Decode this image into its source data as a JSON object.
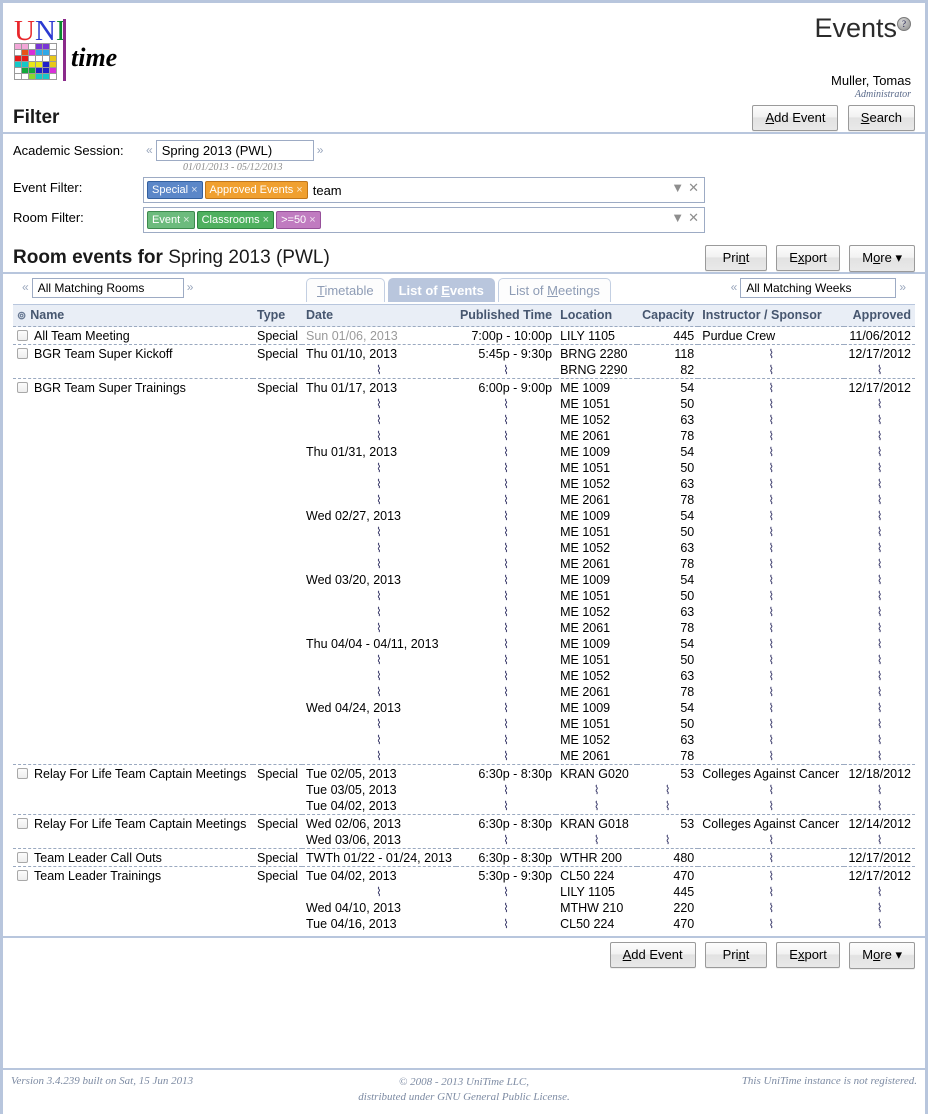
{
  "header": {
    "logo_uni": [
      "U",
      "N",
      "I"
    ],
    "logo_time": "time",
    "app_title": "Events",
    "help_icon": "?",
    "user_name": "Muller, Tomas",
    "user_role": "Administrator"
  },
  "filter": {
    "title": "Filter",
    "add_event_label": "Add Event",
    "add_event_accel": "A",
    "search_label": "Search",
    "search_accel": "S",
    "academic_session_label": "Academic Session:",
    "academic_session_value": "Spring 2013 (PWL)",
    "academic_session_range": "01/01/2013 - 05/12/2013",
    "event_filter_label": "Event Filter:",
    "event_filter_tags": [
      {
        "text": "Special",
        "color": "#5b87c8"
      },
      {
        "text": "Approved Events",
        "color": "#f0a030"
      }
    ],
    "event_filter_text": "team",
    "room_filter_label": "Room Filter:",
    "room_filter_tags": [
      {
        "text": "Event",
        "color": "#6cbb7d"
      },
      {
        "text": "Classrooms",
        "color": "#4eb05f"
      },
      {
        "text": ">=50",
        "color": "#c07bc0"
      }
    ],
    "prev_chevron": "«",
    "next_chevron": "»",
    "dropdown_icon": "▼",
    "clear_icon": "✕",
    "tag_remove": "×"
  },
  "results": {
    "title_prefix": "Room events for ",
    "title_session": "Spring 2013 (PWL)",
    "print_label": "Print",
    "print_accel": "n",
    "export_label": "Export",
    "export_accel": "x",
    "more_label": "More",
    "more_accel": "o",
    "more_caret": "▾",
    "rooms_value": "All Matching Rooms",
    "weeks_value": "All Matching Weeks",
    "tabs": [
      {
        "label": "Timetable",
        "accel": "T",
        "active": false
      },
      {
        "label": "List of Events",
        "accel": "E",
        "active": true
      },
      {
        "label": "List of Meetings",
        "accel": "M",
        "active": false
      }
    ],
    "columns": [
      "Name",
      "Type",
      "Date",
      "Published Time",
      "Location",
      "Capacity",
      "Instructor / Sponsor",
      "Approved"
    ],
    "sort_icon": "⊚",
    "ditto": "⌇",
    "rows": [
      {
        "name": "All Team Meeting",
        "type": "Special",
        "meetings": [
          {
            "date": "Sun 01/06, 2013",
            "date_past": true,
            "time": "7:00p - 10:00p",
            "location": "LILY 1105",
            "capacity": "445",
            "sponsor": "Purdue Crew",
            "approved": "11/06/2012"
          }
        ]
      },
      {
        "name": "BGR Team Super Kickoff",
        "type": "Special",
        "meetings": [
          {
            "date": "Thu 01/10, 2013",
            "time": "5:45p - 9:30p",
            "location": "BRNG 2280",
            "capacity": "118",
            "sponsor": "",
            "approved": "12/17/2012"
          },
          {
            "date": "",
            "time": "",
            "location": "BRNG 2290",
            "capacity": "82",
            "sponsor": "",
            "approved": ""
          }
        ]
      },
      {
        "name": "BGR Team Super Trainings",
        "type": "Special",
        "meetings": [
          {
            "date": "Thu 01/17, 2013",
            "time": "6:00p - 9:00p",
            "location": "ME 1009",
            "capacity": "54",
            "sponsor": "",
            "approved": "12/17/2012"
          },
          {
            "date": "",
            "time": "",
            "location": "ME 1051",
            "capacity": "50",
            "sponsor": "",
            "approved": ""
          },
          {
            "date": "",
            "time": "",
            "location": "ME 1052",
            "capacity": "63",
            "sponsor": "",
            "approved": ""
          },
          {
            "date": "",
            "time": "",
            "location": "ME 2061",
            "capacity": "78",
            "sponsor": "",
            "approved": ""
          },
          {
            "date": "Thu 01/31, 2013",
            "time": "",
            "location": "ME 1009",
            "capacity": "54",
            "sponsor": "",
            "approved": ""
          },
          {
            "date": "",
            "time": "",
            "location": "ME 1051",
            "capacity": "50",
            "sponsor": "",
            "approved": ""
          },
          {
            "date": "",
            "time": "",
            "location": "ME 1052",
            "capacity": "63",
            "sponsor": "",
            "approved": ""
          },
          {
            "date": "",
            "time": "",
            "location": "ME 2061",
            "capacity": "78",
            "sponsor": "",
            "approved": ""
          },
          {
            "date": "Wed 02/27, 2013",
            "time": "",
            "location": "ME 1009",
            "capacity": "54",
            "sponsor": "",
            "approved": ""
          },
          {
            "date": "",
            "time": "",
            "location": "ME 1051",
            "capacity": "50",
            "sponsor": "",
            "approved": ""
          },
          {
            "date": "",
            "time": "",
            "location": "ME 1052",
            "capacity": "63",
            "sponsor": "",
            "approved": ""
          },
          {
            "date": "",
            "time": "",
            "location": "ME 2061",
            "capacity": "78",
            "sponsor": "",
            "approved": ""
          },
          {
            "date": "Wed 03/20, 2013",
            "time": "",
            "location": "ME 1009",
            "capacity": "54",
            "sponsor": "",
            "approved": ""
          },
          {
            "date": "",
            "time": "",
            "location": "ME 1051",
            "capacity": "50",
            "sponsor": "",
            "approved": ""
          },
          {
            "date": "",
            "time": "",
            "location": "ME 1052",
            "capacity": "63",
            "sponsor": "",
            "approved": ""
          },
          {
            "date": "",
            "time": "",
            "location": "ME 2061",
            "capacity": "78",
            "sponsor": "",
            "approved": ""
          },
          {
            "date": "Thu 04/04 - 04/11, 2013",
            "time": "",
            "location": "ME 1009",
            "capacity": "54",
            "sponsor": "",
            "approved": ""
          },
          {
            "date": "",
            "time": "",
            "location": "ME 1051",
            "capacity": "50",
            "sponsor": "",
            "approved": ""
          },
          {
            "date": "",
            "time": "",
            "location": "ME 1052",
            "capacity": "63",
            "sponsor": "",
            "approved": ""
          },
          {
            "date": "",
            "time": "",
            "location": "ME 2061",
            "capacity": "78",
            "sponsor": "",
            "approved": ""
          },
          {
            "date": "Wed 04/24, 2013",
            "time": "",
            "location": "ME 1009",
            "capacity": "54",
            "sponsor": "",
            "approved": ""
          },
          {
            "date": "",
            "time": "",
            "location": "ME 1051",
            "capacity": "50",
            "sponsor": "",
            "approved": ""
          },
          {
            "date": "",
            "time": "",
            "location": "ME 1052",
            "capacity": "63",
            "sponsor": "",
            "approved": ""
          },
          {
            "date": "",
            "time": "",
            "location": "ME 2061",
            "capacity": "78",
            "sponsor": "",
            "approved": ""
          }
        ]
      },
      {
        "name": "Relay For Life Team Captain Meetings",
        "type": "Special",
        "meetings": [
          {
            "date": "Tue 02/05, 2013",
            "time": "6:30p - 8:30p",
            "location": "KRAN G020",
            "capacity": "53",
            "sponsor": "Colleges Against Cancer",
            "approved": "12/18/2012"
          },
          {
            "date": "Tue 03/05, 2013",
            "time": "",
            "location": "",
            "capacity": "",
            "sponsor": "",
            "approved": ""
          },
          {
            "date": "Tue 04/02, 2013",
            "time": "",
            "location": "",
            "capacity": "",
            "sponsor": "",
            "approved": ""
          }
        ]
      },
      {
        "name": "Relay For Life Team Captain Meetings",
        "type": "Special",
        "meetings": [
          {
            "date": "Wed 02/06, 2013",
            "time": "6:30p - 8:30p",
            "location": "KRAN G018",
            "capacity": "53",
            "sponsor": "Colleges Against Cancer",
            "approved": "12/14/2012"
          },
          {
            "date": "Wed 03/06, 2013",
            "time": "",
            "location": "",
            "capacity": "",
            "sponsor": "",
            "approved": ""
          }
        ]
      },
      {
        "name": "Team Leader Call Outs",
        "type": "Special",
        "meetings": [
          {
            "date": "TWTh 01/22 - 01/24, 2013",
            "time": "6:30p - 8:30p",
            "location": "WTHR 200",
            "capacity": "480",
            "sponsor": "",
            "approved": "12/17/2012"
          }
        ]
      },
      {
        "name": "Team Leader Trainings",
        "type": "Special",
        "meetings": [
          {
            "date": "Tue 04/02, 2013",
            "time": "5:30p - 9:30p",
            "location": "CL50 224",
            "capacity": "470",
            "sponsor": "",
            "approved": "12/17/2012"
          },
          {
            "date": "",
            "time": "",
            "location": "LILY 1105",
            "capacity": "445",
            "sponsor": "",
            "approved": ""
          },
          {
            "date": "Wed 04/10, 2013",
            "time": "",
            "location": "MTHW 210",
            "capacity": "220",
            "sponsor": "",
            "approved": ""
          },
          {
            "date": "Tue 04/16, 2013",
            "time": "",
            "location": "CL50 224",
            "capacity": "470",
            "sponsor": "",
            "approved": ""
          }
        ]
      }
    ]
  },
  "bottom_actions": {
    "add_event_label": "Add Event",
    "add_event_accel": "A",
    "print_label": "Print",
    "print_accel": "n",
    "export_label": "Export",
    "export_accel": "x",
    "more_label": "More",
    "more_accel": "o",
    "more_caret": "▾"
  },
  "footer": {
    "version": "Version 3.4.239 built on Sat, 15 Jun 2013",
    "copyright_line1": "© 2008 - 2013 UniTime LLC,",
    "copyright_line2": "distributed under GNU General Public License.",
    "registration": "This UniTime instance is not registered."
  }
}
